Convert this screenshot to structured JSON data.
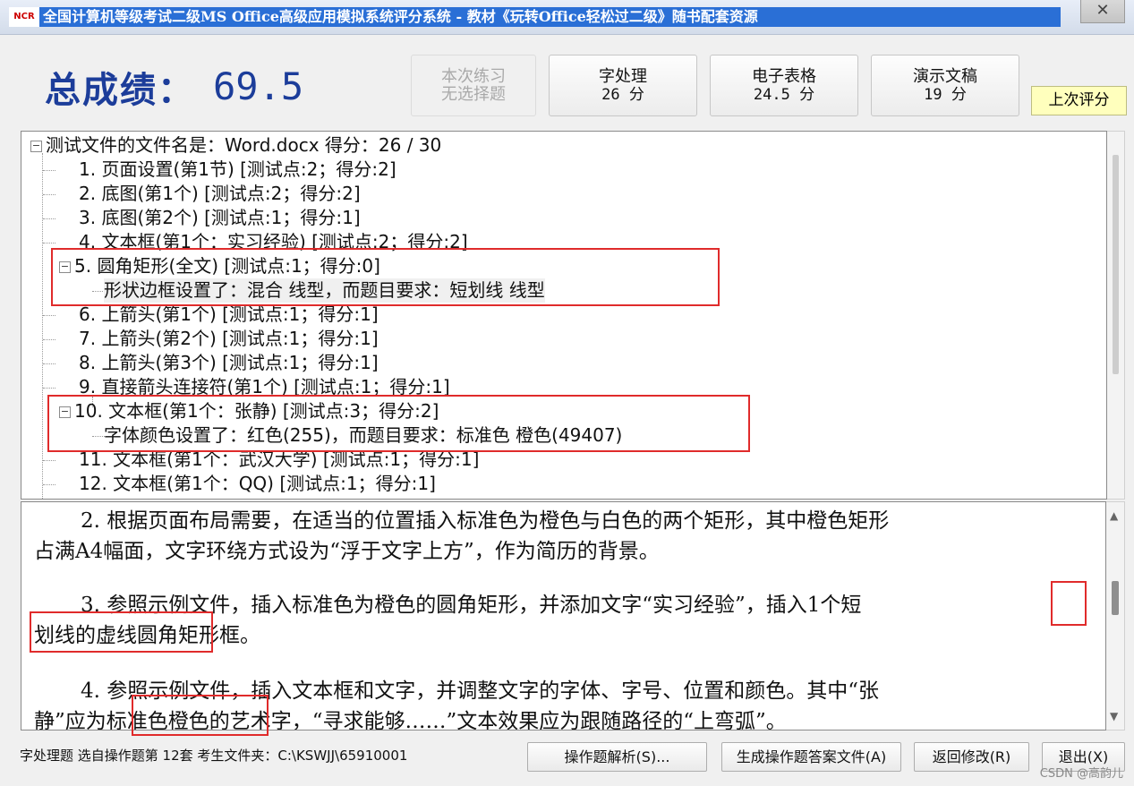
{
  "window": {
    "logo": "NCR",
    "title": "全国计算机等级考试二级MS Office高级应用模拟系统评分系统 - 教材《玩转Office轻松过二级》随书配套资源",
    "close_symbol": "✕"
  },
  "score": {
    "label": "总成绩：",
    "value": "69.5"
  },
  "score_buttons": [
    {
      "line1": "本次练习",
      "line2": "无选择题",
      "disabled": true
    },
    {
      "line1": "字处理",
      "line2": "26 分"
    },
    {
      "line1": "电子表格",
      "line2": "24.5 分"
    },
    {
      "line1": "演示文稿",
      "line2": "19 分"
    }
  ],
  "prev_button": "上次评分",
  "tree": {
    "root": "测试文件的文件名是：Word.docx  得分：26 / 30",
    "items": [
      "1. 页面设置(第1节) [测试点:2；得分:2]",
      "2. 底图(第1个) [测试点:2；得分:2]",
      "3. 底图(第2个) [测试点:1；得分:1]",
      "4. 文本框(第1个：实习经验) [测试点:2；得分:2]",
      "5. 圆角矩形(全文) [测试点:1；得分:0]",
      "形状边框设置了：混合 线型，而题目要求：短划线 线型",
      "6. 上箭头(第1个) [测试点:1；得分:1]",
      "7. 上箭头(第2个) [测试点:1；得分:1]",
      "8. 上箭头(第3个) [测试点:1；得分:1]",
      "9. 直接箭头连接符(第1个) [测试点:1；得分:1]",
      "10. 文本框(第1个：张静) [测试点:3；得分:2]",
      "字体颜色设置了：红色(255)，而题目要求：标准色 橙色(49407)",
      "11. 文本框(第1个：武汉大学) [测试点:1；得分:1]",
      "12. 文本框(第1个：QQ) [测试点:1；得分:1]"
    ],
    "collapse_symbol": "−"
  },
  "description": {
    "p2a": "2. 根据页面布局需要，在适当的位置插入标准色为橙色与白色的两个矩形，其中橙色矩形",
    "p2b": "占满A4幅面，文字环绕方式设为“浮于文字上方”，作为简历的背景。",
    "p3a": "3. 参照示例文件，插入标准色为橙色的圆角矩形，并添加文字“实习经验”，插入1个短",
    "p3b": "划线的虚线圆角矩形框。",
    "p4a": "4. 参照示例文件，插入文本框和文字，并调整文字的字体、字号、位置和颜色。其中“张",
    "p4b": "静”应为标准色橙色的艺术字，“寻求能够……”文本效果应为跟随路径的“上弯弧”。"
  },
  "status": "字处理题 选自操作题第 12套  考生文件夹：C:\\KSWJJ\\65910001",
  "actions": {
    "analysis": "操作题解析(S)...",
    "generate": "生成操作题答案文件(A)",
    "back": "返回修改(R)",
    "exit": "退出(X)"
  },
  "watermark": "CSDN @高韵儿",
  "scroll_arrows": {
    "up": "▲",
    "down": "▼"
  },
  "colors": {
    "title_bg": "#2a6fd6",
    "score_text": "#1c3d9a",
    "highlight": "#e02b2b",
    "prev_btn_bg": "#ffffbd"
  }
}
